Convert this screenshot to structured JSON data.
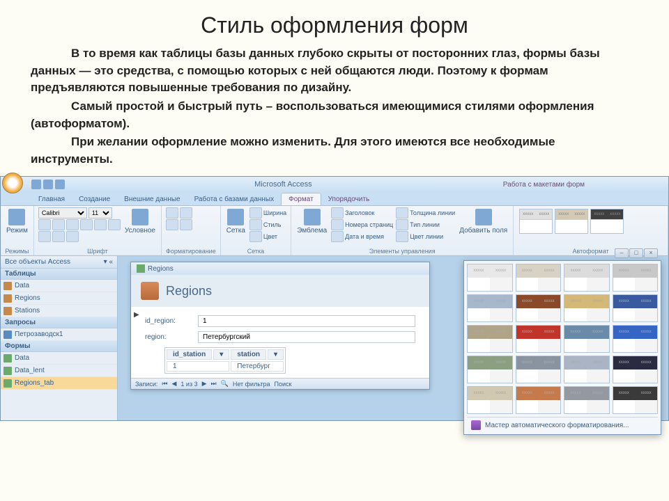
{
  "title": "Стиль оформления форм",
  "paragraphs": [
    "В то время как таблицы базы данных глубоко скрыты от посторонних глаз, формы базы данных — это средства, с помощью которых с ней общаются люди. Поэтому к формам предъявляются повышенные требования по дизайну.",
    "Самый простой и быстрый путь – воспользоваться имеющимися стилями оформления (автоформатом).",
    "При желании оформление можно изменить. Для этого имеются все необходимые инструменты."
  ],
  "app": {
    "title": "Microsoft Access",
    "context_group": "Работа с макетами форм",
    "tabs": [
      "Главная",
      "Создание",
      "Внешние данные",
      "Работа с базами данных"
    ],
    "context_tabs": [
      "Формат",
      "Упорядочить"
    ],
    "active_tab": "Формат",
    "ribbon": {
      "groups": {
        "modes": "Режимы",
        "font": "Шрифт",
        "formatting": "Форматирование",
        "grid": "Сетка",
        "controls": "Элементы управления",
        "autoformat": "Автоформат"
      },
      "mode_btn": "Режим",
      "font_name": "Calibri",
      "font_size": "11",
      "conditional": "Условное",
      "grid_btn": "Сетка",
      "width": "Ширина",
      "style": "Стиль",
      "color": "Цвет",
      "emblem": "Эмблема",
      "header_cb": "Заголовок",
      "pagenum_cb": "Номера страниц",
      "datetime_cb": "Дата и время",
      "line_thickness": "Толщина линии",
      "line_type": "Тип линии",
      "line_color": "Цвет линии",
      "add_fields": "Добавить поля",
      "thumb_label": "xxxxx"
    },
    "nav": {
      "header": "Все объекты Access",
      "groups": {
        "tables": "Таблицы",
        "queries": "Запросы",
        "forms": "Формы"
      },
      "tables": [
        "Data",
        "Regions",
        "Stations"
      ],
      "queries": [
        "Петрозаводск1"
      ],
      "forms": [
        "Data",
        "Data_lent",
        "Regions_tab"
      ]
    },
    "form": {
      "window_title": "Regions",
      "header": "Regions",
      "fields": {
        "id_region_label": "id_region:",
        "id_region_value": "1",
        "region_label": "region:",
        "region_value": "Петербургский"
      },
      "subtable": {
        "cols": [
          "id_station",
          "station"
        ],
        "row": [
          "1",
          "Петербург"
        ]
      },
      "recordnav": {
        "label": "Записи:",
        "position": "1 из 3",
        "filter": "Нет фильтра",
        "search": "Поиск"
      }
    },
    "autoformat_popup": {
      "thumb_label": "xxxxx",
      "colors": [
        [
          "#e8e8e8",
          "#d8d2c4",
          "#dcdcdc",
          "#c8c8c8"
        ],
        [
          "#a8b8cc",
          "#8a4a2a",
          "#d4b878",
          "#3a5aa0"
        ],
        [
          "#b0a488",
          "#c0342a",
          "#6a8aaa",
          "#3464c4"
        ],
        [
          "#8aa080",
          "#8a94a0",
          "#aab4c4",
          "#2a2a40"
        ],
        [
          "#d0c8b0",
          "#c47a4a",
          "#9498a0",
          "#3a3a3a"
        ]
      ],
      "footer": "Мастер автоматического форматирования..."
    }
  }
}
